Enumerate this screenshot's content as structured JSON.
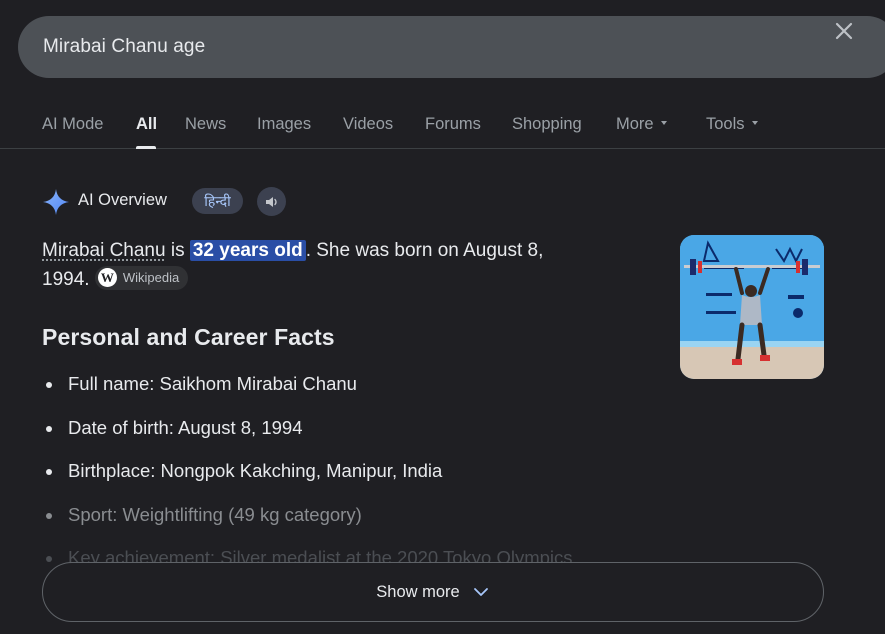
{
  "search": {
    "query": "Mirabai Chanu age",
    "clear_icon": "close-icon"
  },
  "tabs": [
    {
      "label": "AI Mode"
    },
    {
      "label": "All",
      "active": true
    },
    {
      "label": "News"
    },
    {
      "label": "Images"
    },
    {
      "label": "Videos"
    },
    {
      "label": "Forums"
    },
    {
      "label": "Shopping"
    },
    {
      "label": "More",
      "dropdown": true
    },
    {
      "label": "Tools",
      "dropdown": true
    }
  ],
  "ai_overview": {
    "title": "AI Overview",
    "language_button": "हिन्दी",
    "speaker_icon": "speaker-icon",
    "answer": {
      "subject": "Mirabai Chanu",
      "is_text": " is ",
      "highlight": "32 years old",
      "rest_line1": ". She was born on August 8,",
      "rest_line2": "1994.",
      "source_label": "Wikipedia",
      "source_logo": "W"
    },
    "section_heading": "Personal and Career Facts",
    "facts": [
      "Full name: Saikhom Mirabai Chanu",
      "Date of birth: August 8, 1994",
      "Birthplace: Nongpok Kakching, Manipur, India",
      "Sport: Weightlifting (49 kg category)",
      "Key achievement: Silver medalist at the 2020 Tokyo Olympics"
    ],
    "show_more": "Show more"
  },
  "colors": {
    "background": "#1f1f23",
    "search_bar": "#4d5156",
    "highlight": "#2a4ea6",
    "accent_blue": "#a8c7fa"
  }
}
